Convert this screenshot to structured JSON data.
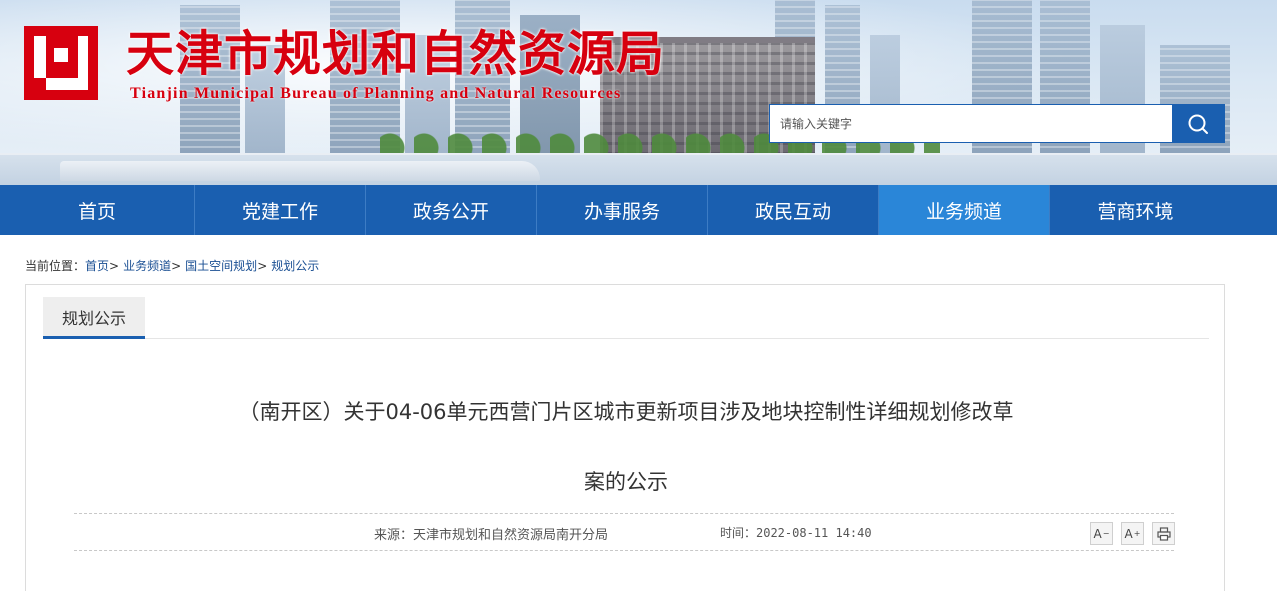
{
  "header": {
    "title": "天津市规划和自然资源局",
    "subtitle": "Tianjin Municipal Bureau of Planning and Natural Resources",
    "brand_color": "#d7000f",
    "logo_icon": "bureau-logo-icon"
  },
  "search": {
    "placeholder": "请输入关键字",
    "button_icon": "search-icon"
  },
  "nav": {
    "items": [
      {
        "label": "首页",
        "active": false
      },
      {
        "label": "党建工作",
        "active": false
      },
      {
        "label": "政务公开",
        "active": false
      },
      {
        "label": "办事服务",
        "active": false
      },
      {
        "label": "政民互动",
        "active": false
      },
      {
        "label": "业务频道",
        "active": true
      },
      {
        "label": "营商环境",
        "active": false
      }
    ],
    "bg_color": "#1a5fb0",
    "active_color": "#2a86d8"
  },
  "breadcrumb": {
    "prefix": "当前位置：",
    "items": [
      "首页",
      "业务频道",
      "国土空间规划",
      "规划公示"
    ],
    "separator": ">"
  },
  "panel": {
    "tab_label": "规划公示"
  },
  "article": {
    "title_line1": "（南开区）关于04-06单元西营门片区城市更新项目涉及地块控制性详细规划修改草",
    "title_line2": "案的公示",
    "source": "来源：天津市规划和自然资源局南开分局",
    "time": "时间：2022-08-11 14:40"
  },
  "tools": {
    "font_smaller": "A",
    "font_smaller_sup": "−",
    "font_larger": "A",
    "font_larger_sup": "+",
    "print_icon": "print-icon"
  }
}
